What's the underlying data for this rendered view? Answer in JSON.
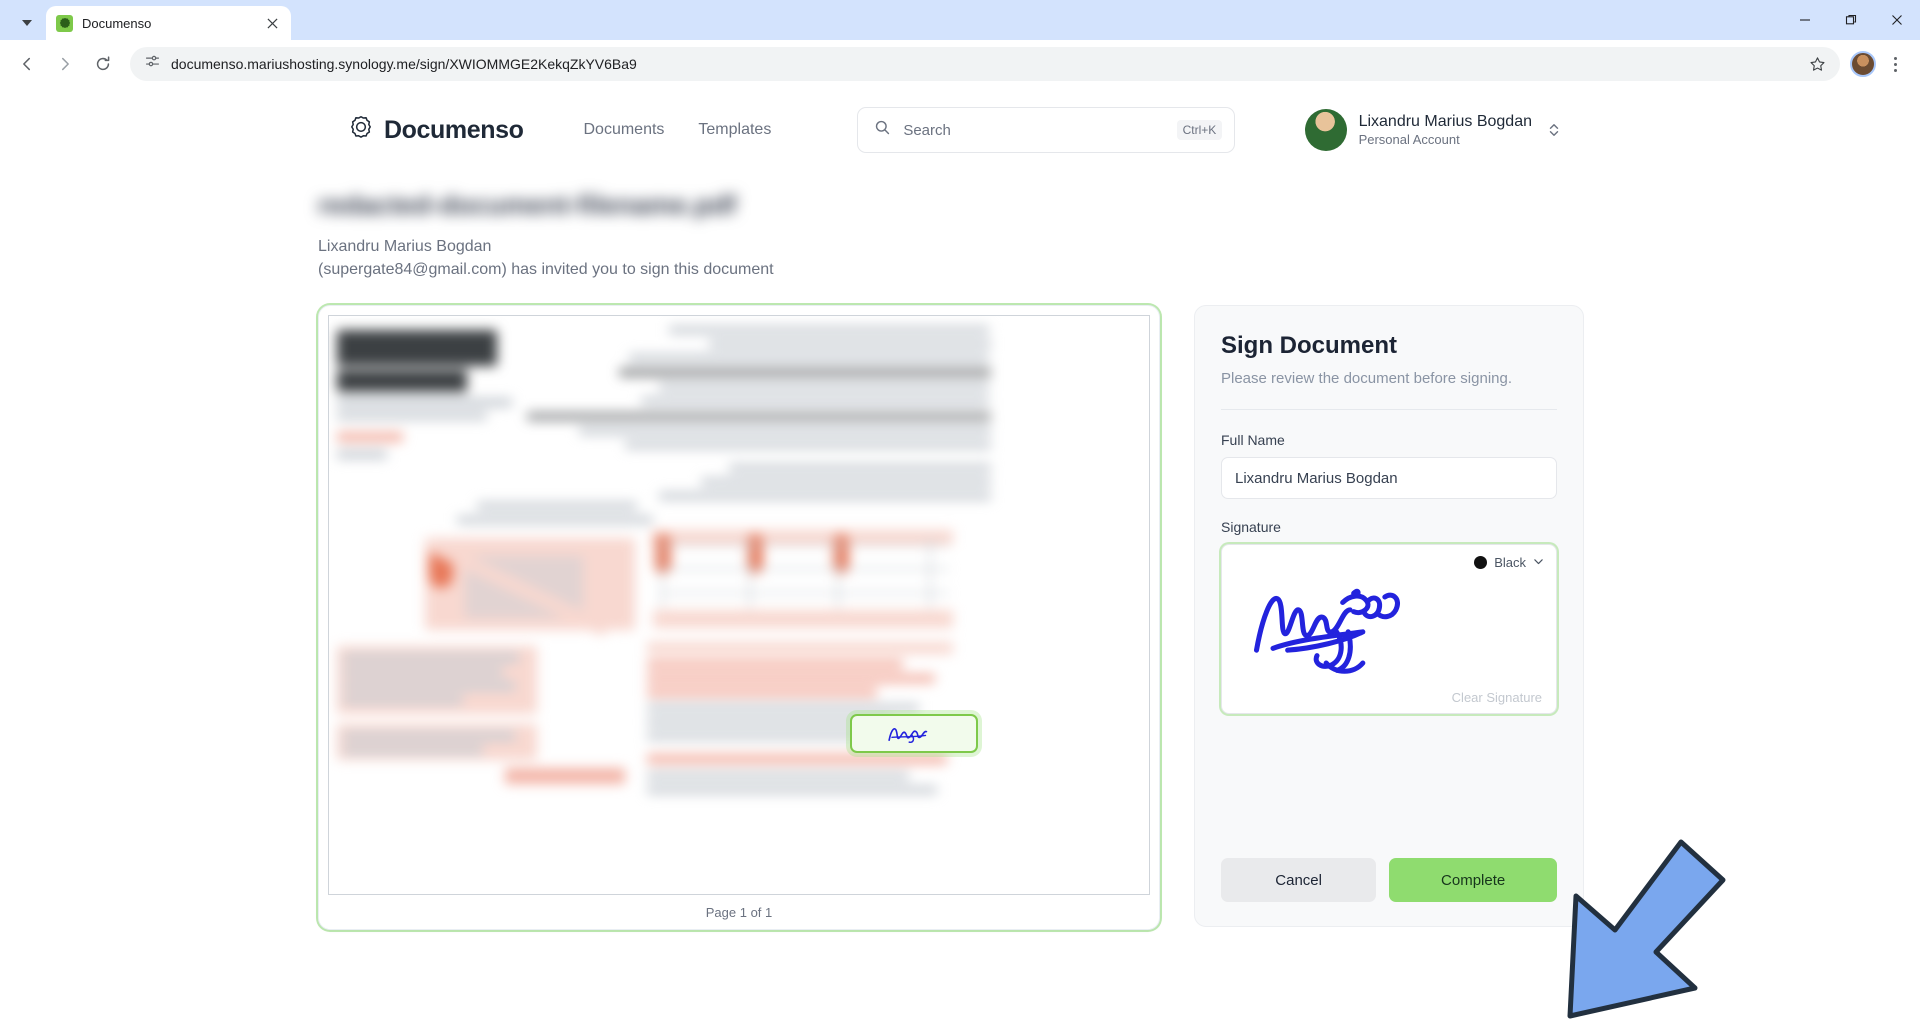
{
  "browser": {
    "tab": {
      "title": "Documenso",
      "favicon_icon": "documenso-favicon",
      "close_icon": "close-icon"
    },
    "tablist_chevron_icon": "chevron-down-icon",
    "window_controls": {
      "minimize": "–",
      "maximize": "❐",
      "close": "✕"
    },
    "nav": {
      "back_icon": "arrow-left-icon",
      "forward_icon": "arrow-right-icon",
      "reload_icon": "reload-icon"
    },
    "omnibox": {
      "site_settings_icon": "page-settings-icon",
      "url": "documenso.mariushosting.synology.me/sign/XWIOMMGE2KekqZkYV6Ba9",
      "bookmark_icon": "star-icon"
    },
    "profile_icon": "profile-avatar-icon",
    "menu_icon": "kebab-menu-icon"
  },
  "header": {
    "logo_icon": "documenso-logo-icon",
    "brand": "Documenso",
    "nav": [
      {
        "label": "Documents",
        "name": "nav-documents"
      },
      {
        "label": "Templates",
        "name": "nav-templates"
      }
    ],
    "search": {
      "icon": "search-icon",
      "placeholder": "Search",
      "shortcut": "Ctrl+K"
    },
    "user": {
      "name": "Lixandru Marius Bogdan",
      "account_type": "Personal Account",
      "avatar_icon": "user-avatar",
      "switcher_icon": "chevron-up-down-icon"
    }
  },
  "document": {
    "title_redacted": "redacted-document-filename.pdf",
    "inviter_name": "Lixandru Marius Bogdan",
    "invite_line": "(supergate84@gmail.com) has invited you to sign this document",
    "page_indicator": "Page 1 of 1",
    "signature_field_label": "signature-field"
  },
  "sign_panel": {
    "title": "Sign Document",
    "subtitle": "Please review the document before signing.",
    "full_name_label": "Full Name",
    "full_name_value": "Lixandru Marius Bogdan",
    "signature_label": "Signature",
    "color_name": "Black",
    "color_hex": "#111111",
    "color_chevron_icon": "chevron-down-icon",
    "clear_signature": "Clear Signature",
    "cancel_label": "Cancel",
    "complete_label": "Complete",
    "complete_color": "#8fdc6f",
    "signature_ink_hex": "#2323dd"
  },
  "annotation": {
    "arrow_icon": "pointer-arrow-icon",
    "arrow_fill": "#7aa7ee",
    "arrow_stroke": "#22303f",
    "points_to": "Complete"
  }
}
